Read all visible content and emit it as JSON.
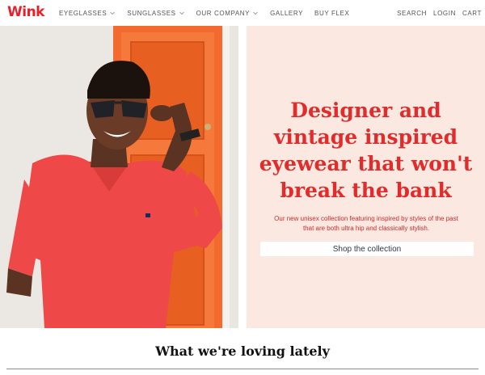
{
  "header": {
    "logo": "Wink",
    "nav": [
      {
        "label": "EYEGLASSES",
        "has_dropdown": true
      },
      {
        "label": "SUNGLASSES",
        "has_dropdown": true
      },
      {
        "label": "OUR COMPANY",
        "has_dropdown": true
      },
      {
        "label": "GALLERY",
        "has_dropdown": false
      },
      {
        "label": "BUY FLEX",
        "has_dropdown": false
      }
    ],
    "utility": {
      "search": "SEARCH",
      "login": "LOGIN",
      "cart": "CART"
    }
  },
  "hero": {
    "headline_lines": [
      "Designer and",
      "vintage inspired",
      "eyewear that won't",
      "break the bank"
    ],
    "subtext_lines": [
      "Our new unisex collection featuring inspired by styles of the past",
      "that are both ultra hip and classically stylish."
    ],
    "cta_label": "Shop the collection",
    "image": "man-in-red-polo-wearing-sunglasses-photo"
  },
  "section": {
    "title": "What we're loving lately"
  },
  "colors": {
    "brand_red": "#e22b2b",
    "panel_bg": "#fbe9e1",
    "door_orange": "#f2672a",
    "shirt_red": "#ee4848"
  },
  "icons": [
    "chevron-down-icon"
  ]
}
